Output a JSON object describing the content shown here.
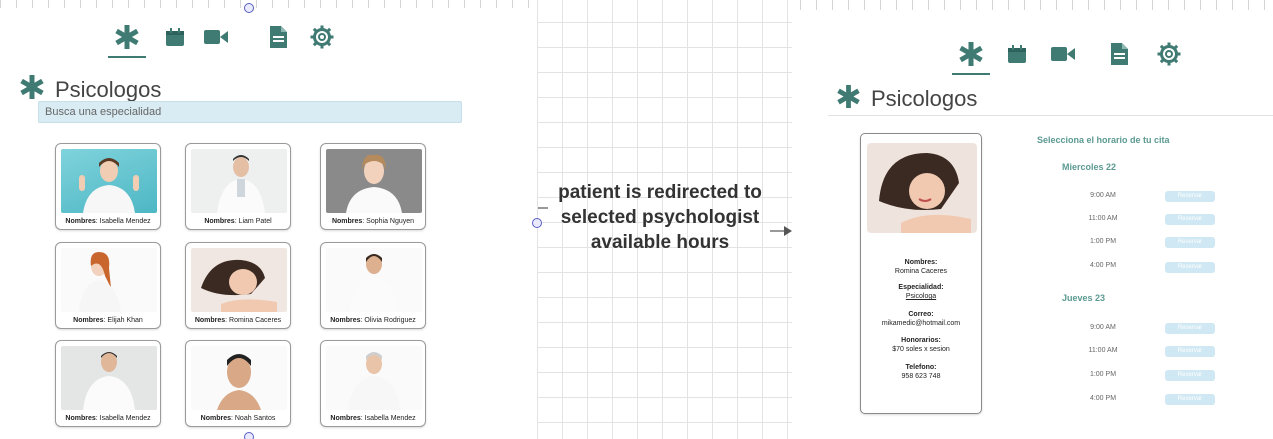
{
  "left_screen": {
    "title": "Psicologos",
    "search_placeholder": "Busca una especialidad",
    "name_label": "Nombres",
    "cards": [
      {
        "name": ": Isabella Mendez"
      },
      {
        "name": ": Liam Patel"
      },
      {
        "name": ": Sophia Nguyen"
      },
      {
        "name": ": Elijah Khan"
      },
      {
        "name": ": Romina Caceres"
      },
      {
        "name": ": Olivia Rodriguez"
      },
      {
        "name": ": Isabella Mendez"
      },
      {
        "name": ": Noah Santos"
      },
      {
        "name": ": Isabella Mendez"
      }
    ]
  },
  "annotation": {
    "text_line1": "patient is redirected to",
    "text_line2": "selected psychologist",
    "text_line3": "available hours"
  },
  "right_screen": {
    "title": "Psicologos",
    "profile": {
      "name_label": "Nombres:",
      "name": "Romina Caceres",
      "specialty_label": "Especialidad:",
      "specialty": "Psicologa",
      "email_label": "Correo:",
      "email": "mikamedic@hotmail.com",
      "fees_label": "Honorarios:",
      "fees": "$70 soles x sesion",
      "phone_label": "Telefono:",
      "phone": "958 623 748"
    },
    "schedule_title": "Selecciona el horario de tu cita",
    "reserve_label": "Reservar",
    "days": [
      {
        "label": "Miercoles 22",
        "times": [
          "9:00 AM",
          "11:00 AM",
          "1:00 PM",
          "4:00 PM"
        ]
      },
      {
        "label": "Jueves 23",
        "times": [
          "9:00 AM",
          "11:00 AM",
          "1:00 PM",
          "4:00 PM"
        ]
      }
    ]
  },
  "colors": {
    "accent": "#3f7a73",
    "accent_light": "#5b9a92",
    "search_bg": "#d9ecf3",
    "reserve_bg": "#cfe8f3"
  },
  "icons": [
    "asterisk-icon",
    "calendar-icon",
    "video-icon",
    "document-icon",
    "gear-icon"
  ]
}
